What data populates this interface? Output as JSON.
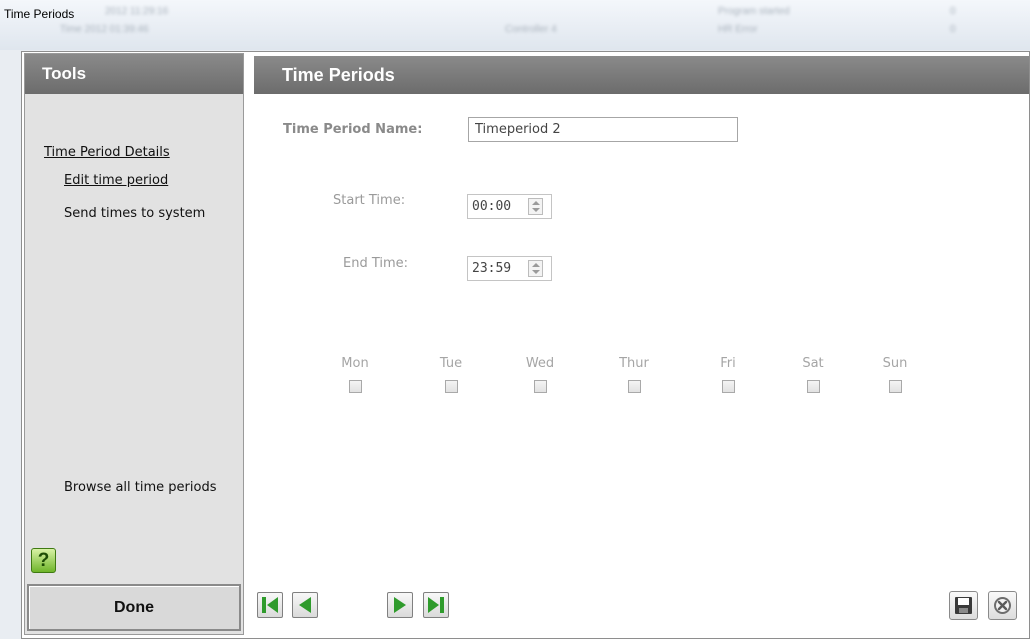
{
  "window": {
    "title": "Time Periods"
  },
  "background_log": [
    "2012 11:29:16",
    "Time 2012 01:39:46",
    "Controller 4",
    "Program started",
    "HR Error",
    "0",
    "0"
  ],
  "sidebar": {
    "header": "Tools",
    "items": [
      {
        "label": "Time Period Details",
        "underline": true
      },
      {
        "label": "Edit time period",
        "underline": true
      },
      {
        "label": "Send times to system",
        "underline": false
      }
    ],
    "browse_label": "Browse all time periods",
    "help_label": "?",
    "done_label": "Done"
  },
  "main": {
    "header": "Time Periods",
    "name_label": "Time Period Name:",
    "name_value": "Timeperiod 2",
    "start_label": "Start Time:",
    "start_value": "00:00",
    "end_label": "End Time:",
    "end_value": "23:59",
    "days": [
      "Mon",
      "Tue",
      "Wed",
      "Thur",
      "Fri",
      "Sat",
      "Sun"
    ]
  },
  "toolbar": {
    "nav_icons": [
      "first-record-icon",
      "previous-record-icon",
      "next-record-icon",
      "last-record-icon"
    ],
    "save_icon": "save-icon",
    "cancel_icon": "cancel-icon"
  },
  "colors": {
    "header_bg": "#787878",
    "nav_green": "#2f9b2c",
    "sidebar_bg": "#e2e2e2"
  }
}
